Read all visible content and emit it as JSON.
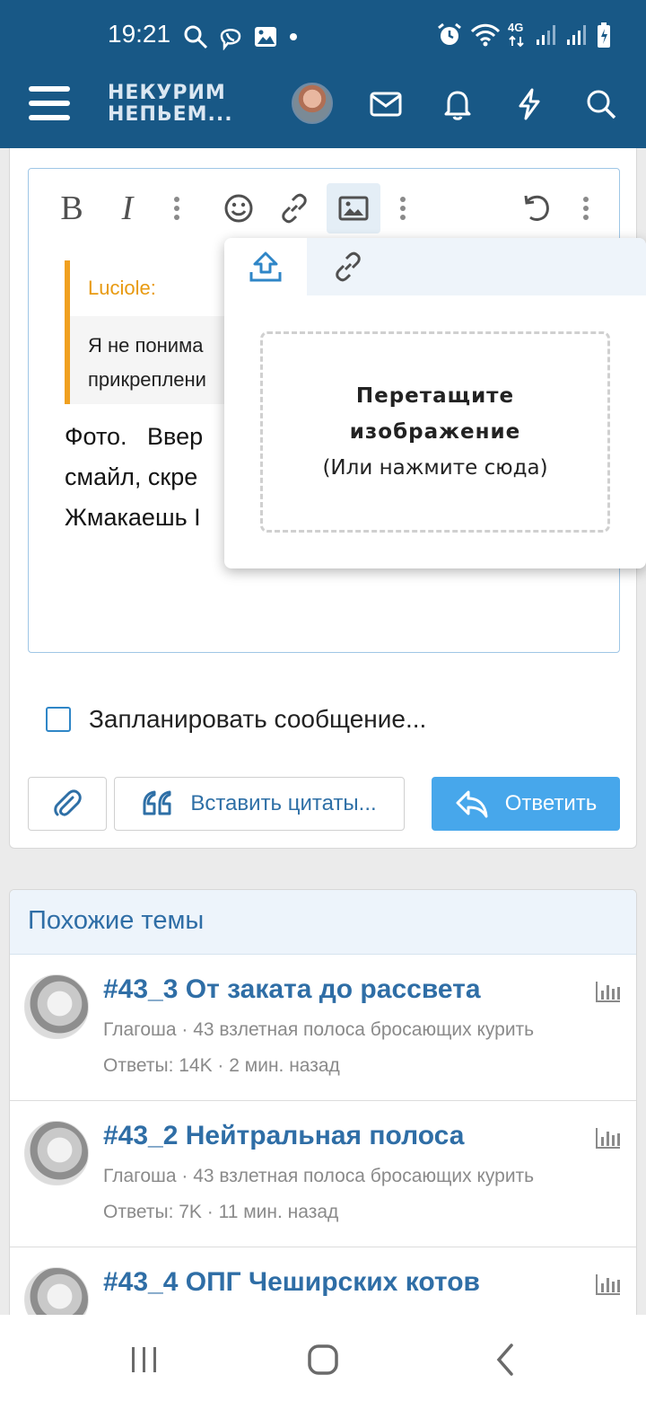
{
  "status_bar": {
    "time": "19:21",
    "network": "4G",
    "left_icons": [
      "search-icon",
      "viber-icon",
      "gallery-icon",
      "dot-icon"
    ],
    "right_icons": [
      "alarm-icon",
      "wifi-icon",
      "signal-icon",
      "signal-icon",
      "battery-icon"
    ]
  },
  "header": {
    "logo_line1": "НЕКУРИМ",
    "logo_line2": "НЕПЬЕМ...",
    "icons": [
      "menu-icon",
      "avatar",
      "mail-icon",
      "bell-icon",
      "bolt-icon",
      "search-icon"
    ],
    "bar_color": "#185886"
  },
  "editor": {
    "toolbar": [
      "bold",
      "italic",
      "more",
      "emoji",
      "link",
      "image",
      "more",
      "undo",
      "more"
    ],
    "bold_label": "B",
    "italic_label": "I",
    "quote_author": "Luciole:",
    "quote_line1": "Я не понима",
    "quote_line2": "прикреплени",
    "body_line1": "Фото.   Ввер",
    "body_line2": "смайл, скре",
    "body_line3": "Жмакаешь I"
  },
  "image_popup": {
    "tabs": [
      "upload-icon",
      "link-icon"
    ],
    "active_tab": 0,
    "dropzone_title_line1": "Перетащите",
    "dropzone_title_line2": "изображение",
    "dropzone_subtitle": "(Или нажмите сюда)"
  },
  "schedule": {
    "label": "Запланировать сообщение...",
    "checked": false
  },
  "actions": {
    "insert_quotes": "Вставить цитаты...",
    "reply": "Ответить",
    "accent": "#47a7eb"
  },
  "similar": {
    "heading": "Похожие темы",
    "items": [
      {
        "title": "#43_3 От заката до рассвета",
        "author": "Глагоша · 43 взлетная полоса бросающих курить",
        "stats": "Ответы: 14K · 2 мин. назад"
      },
      {
        "title": "#43_2 Нейтральная полоса",
        "author": "Глагоша · 43 взлетная полоса бросающих курить",
        "stats": "Ответы: 7K · 11 мин. назад"
      },
      {
        "title": "#43_4 ОПГ Чеширских котов",
        "author": "",
        "stats": ""
      }
    ]
  },
  "nav": [
    "recents-icon",
    "home-icon",
    "back-icon"
  ]
}
